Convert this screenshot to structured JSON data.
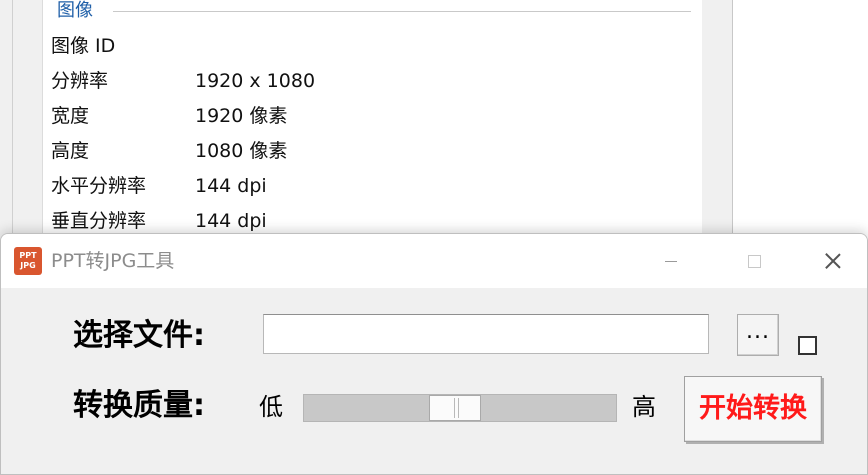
{
  "background_window": {
    "group_title": "图像",
    "properties": [
      {
        "name": "图像 ID",
        "value": ""
      },
      {
        "name": "分辨率",
        "value": "1920 x 1080"
      },
      {
        "name": "宽度",
        "value": "1920 像素"
      },
      {
        "name": "高度",
        "value": "1080 像素"
      },
      {
        "name": "水平分辨率",
        "value": "144 dpi"
      },
      {
        "name": "垂直分辨率",
        "value": "144 dpi"
      }
    ]
  },
  "dialog": {
    "app_icon_text": [
      "PPT",
      "JPG"
    ],
    "title": "PPT转JPG工具",
    "file_label": "选择文件:",
    "file_input_value": "",
    "browse_label": "...",
    "quality_label": "转换质量:",
    "quality_low": "低",
    "quality_high": "高",
    "quality_value_fraction": 0.48,
    "start_button": "开始转换",
    "colors": {
      "start_text": "#ff1a1a",
      "icon_bg": "#d9562f",
      "group_title": "#1f5fa8"
    }
  }
}
